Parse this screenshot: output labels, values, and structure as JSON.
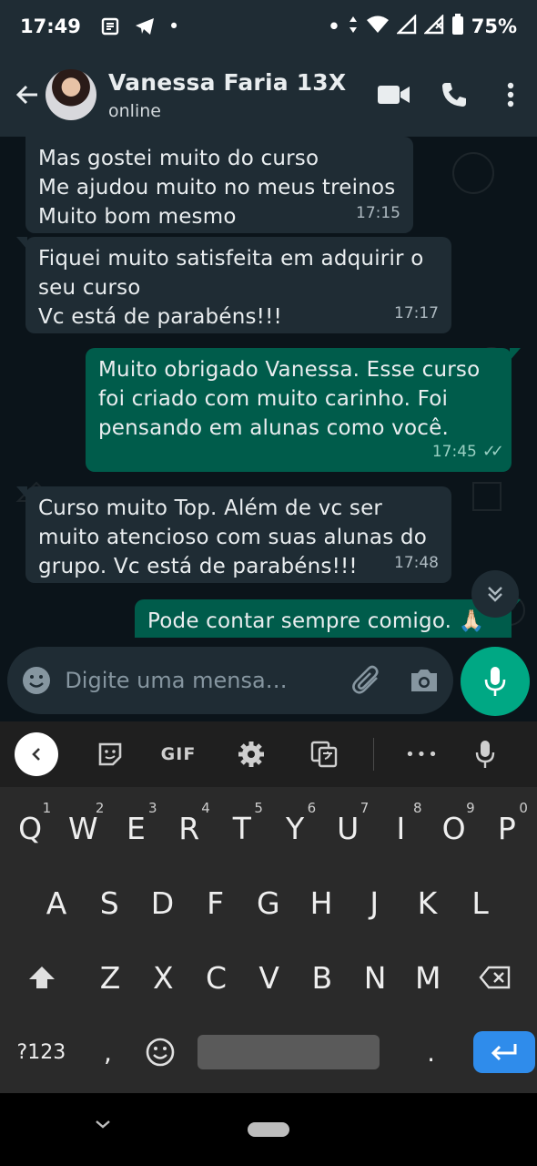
{
  "status_bar": {
    "time": "17:49",
    "dot": "•",
    "dot2": "•",
    "battery": "75%"
  },
  "header": {
    "contact_name": "Vanessa Faria 13X",
    "presence": "online"
  },
  "messages": [
    {
      "dir": "in",
      "text": "Mas gostei muito do curso\nMe ajudou muito no meus treinos\nMuito bom mesmo",
      "time": "17:15"
    },
    {
      "dir": "in",
      "text": "Fiquei muito satisfeita em adquirir o\nseu curso\nVc está de parabéns!!!",
      "time": "17:17"
    },
    {
      "dir": "out",
      "text": "Muito obrigado Vanessa. Esse curso\nfoi criado com muito carinho. Foi\npensando em alunas como você.",
      "time": "17:45",
      "ticks": "✓✓"
    },
    {
      "dir": "in",
      "text": "Curso muito Top. Além de vc ser\nmuito atencioso com suas alunas do\ngrupo. Vc está de parabéns!!!",
      "time": "17:48"
    },
    {
      "dir": "out",
      "text": "Pode contar sempre comigo. 🙏🏻",
      "time": ""
    }
  ],
  "composer": {
    "placeholder": "Digite uma mensa…"
  },
  "keyboard_toolbar": {
    "gif_label": "GIF",
    "more": "•••"
  },
  "keyboard": {
    "row1": [
      {
        "k": "Q",
        "h": "1"
      },
      {
        "k": "W",
        "h": "2"
      },
      {
        "k": "E",
        "h": "3"
      },
      {
        "k": "R",
        "h": "4"
      },
      {
        "k": "T",
        "h": "5"
      },
      {
        "k": "Y",
        "h": "6"
      },
      {
        "k": "U",
        "h": "7"
      },
      {
        "k": "I",
        "h": "8"
      },
      {
        "k": "O",
        "h": "9"
      },
      {
        "k": "P",
        "h": "0"
      }
    ],
    "row2": [
      "A",
      "S",
      "D",
      "F",
      "G",
      "H",
      "J",
      "K",
      "L"
    ],
    "row3": [
      "Z",
      "X",
      "C",
      "V",
      "B",
      "N",
      "M"
    ],
    "symbols_key": "?123",
    "comma": ",",
    "period": "."
  },
  "colors": {
    "header_bg": "#1f2c34",
    "incoming_bubble": "#1f2c34",
    "outgoing_bubble": "#005c4b",
    "accent_green": "#00a884",
    "enter_key": "#2f8ceb"
  }
}
